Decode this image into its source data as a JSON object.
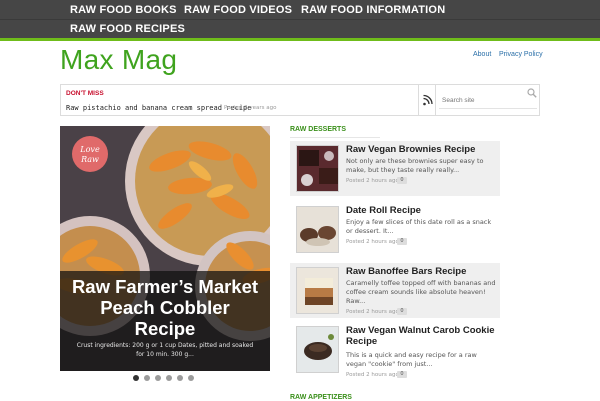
{
  "nav": {
    "items": [
      "RAW FOOD BOOKS",
      "RAW FOOD VIDEOS",
      "RAW FOOD INFORMATION",
      "RAW FOOD RECIPES"
    ]
  },
  "site": {
    "logo": "Max Mag",
    "links": [
      "About",
      "Privacy Policy"
    ]
  },
  "ticker": {
    "label": "DON'T MISS",
    "title": "Raw pistachio and banana cream spread recipe",
    "meta": "Posted 2 years ago"
  },
  "search": {
    "placeholder": "Search site"
  },
  "slider": {
    "title": "Raw Farmer’s Market Peach Cobbler Recipe",
    "excerpt": "Crust ingredients: 200 g or 1 cup Dates, pitted and soaked for 10 min. 300 g...",
    "badge": "Love Raw",
    "dots": 6,
    "active_dot": 0
  },
  "sections": {
    "desserts": "RAW DESSERTS",
    "appetizers": "RAW APPETIZERS"
  },
  "posts": [
    {
      "title": "Raw Vegan Brownies Recipe",
      "excerpt": "Not only are these brownies super easy to make, but they taste really really...",
      "meta": "Posted 2 hours ago",
      "comments": "0"
    },
    {
      "title": "Date Roll Recipe",
      "excerpt": "Enjoy a few slices of this date roll as a snack or dessert. It...",
      "meta": "Posted 2 hours ago",
      "comments": "0"
    },
    {
      "title": "Raw Banoffee Bars Recipe",
      "excerpt": "Caramelly toffee topped off with bananas and coffee cream sounds like absolute heaven! Raw...",
      "meta": "Posted 2 hours ago",
      "comments": "0"
    },
    {
      "title": "Raw Vegan Walnut Carob Cookie Recipe",
      "excerpt": "This is a quick and easy recipe for a raw vegan \"cookie\" from just...",
      "meta": "Posted 2 hours ago",
      "comments": "0"
    }
  ],
  "colors": {
    "nav_bg": "#464646",
    "accent_green": "#6fbc1a",
    "logo_green": "#3fa31e",
    "alert_red": "#c8102e"
  }
}
